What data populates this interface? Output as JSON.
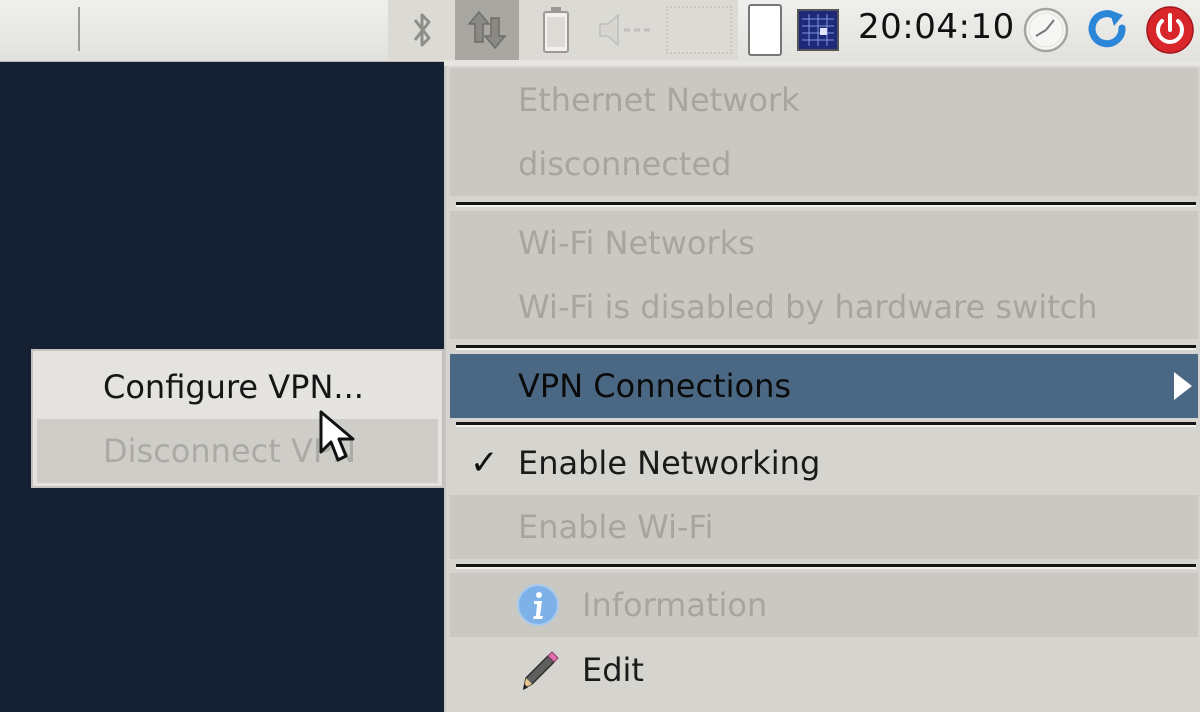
{
  "panel": {
    "clock": "20:04:10",
    "icons": [
      "bluetooth-icon",
      "network-icon",
      "battery-icon",
      "volume-icon",
      "notification-icon",
      "workspace-icon",
      "monitor-icon",
      "clock-icon",
      "refresh-icon",
      "power-icon"
    ],
    "colors": {
      "panel": "#e8e7e3",
      "active_tray": "#a8a7a2",
      "power": "#d8262b",
      "refresh": "#2b86d8"
    }
  },
  "menu": {
    "ethernet_header": "Ethernet Network",
    "ethernet_status": "disconnected",
    "wifi_header": "Wi-Fi Networks",
    "wifi_status": "Wi-Fi is disabled by hardware switch",
    "vpn_connections": "VPN Connections",
    "enable_networking": "Enable Networking",
    "enable_networking_checked": true,
    "enable_wifi": "Enable Wi-Fi",
    "information": "Information",
    "edit": "Edit",
    "check_mark": "✓",
    "highlight_color": "#4a6884"
  },
  "submenu": {
    "configure_vpn": "Configure VPN...",
    "disconnect_vpn": "Disconnect VPN"
  }
}
